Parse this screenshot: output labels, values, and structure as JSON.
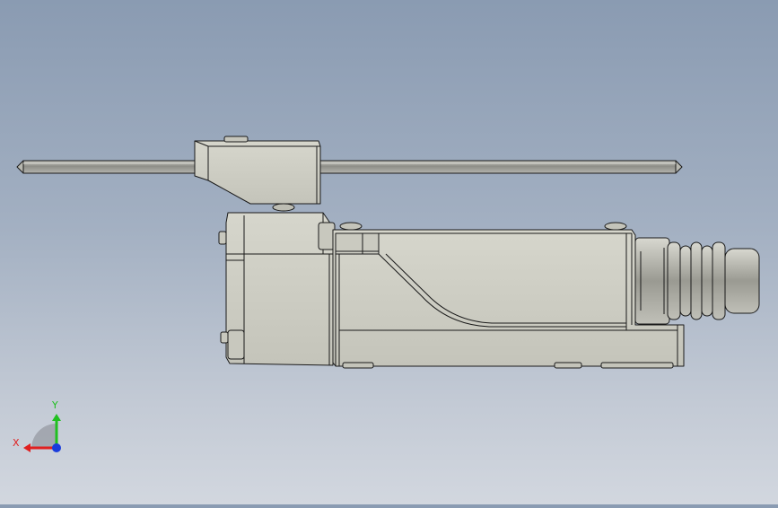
{
  "triad": {
    "x_label": "X",
    "y_label": "Y",
    "x_color": "#e02020",
    "y_color": "#20c020",
    "z_color": "#1a3cdc"
  },
  "model": {
    "body_color": "#cfcfc5",
    "edge_color": "#1a1a1a",
    "rod_color": "#a9a9a3"
  }
}
